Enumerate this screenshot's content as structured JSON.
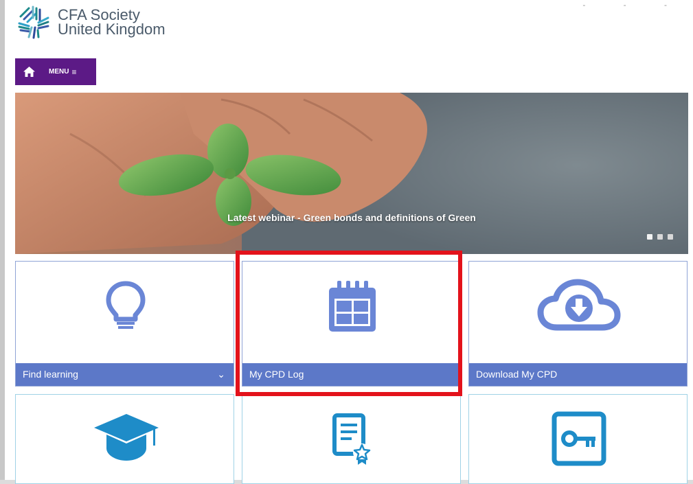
{
  "logo": {
    "line1": "CFA Society",
    "line2": "United Kingdom"
  },
  "menu": {
    "label": "MENU",
    "burger": "≡"
  },
  "hero": {
    "caption": "Latest webinar - Green bonds and definitions of Green",
    "slides_count": 3
  },
  "tiles": [
    {
      "label": "Find learning",
      "icon": "lightbulb-icon",
      "chevron": "⌄"
    },
    {
      "label": "My CPD Log",
      "icon": "calendar-icon"
    },
    {
      "label": "Download My CPD",
      "icon": "cloud-download-icon"
    },
    {
      "label": "",
      "icon": "graduation-cap-icon"
    },
    {
      "label": "",
      "icon": "certificate-icon"
    },
    {
      "label": "",
      "icon": "key-icon"
    }
  ],
  "window_controls": "- - -",
  "colors": {
    "menu_purple": "#5c1a86",
    "tile_blue": "#5c78c8",
    "icon_blue": "#6a86d6",
    "icon_cyan": "#1e8cc8",
    "highlight_red": "#e3121b"
  }
}
